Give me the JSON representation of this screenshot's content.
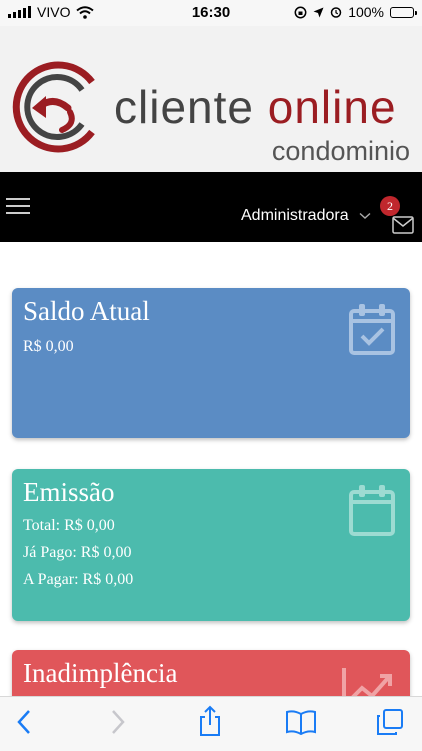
{
  "status_bar": {
    "carrier": "VIVO",
    "time": "16:30",
    "battery": "100%"
  },
  "logo": {
    "word1": "cliente",
    "word2": "online",
    "sub": "condominio"
  },
  "nav": {
    "user_menu_label": "Administradora",
    "messages_badge": "2"
  },
  "cards": {
    "saldo": {
      "title": "Saldo Atual",
      "value": "R$ 0,00",
      "color": "#5b8cc4"
    },
    "emissao": {
      "title": "Emissão",
      "total": "Total: R$ 0,00",
      "ja_pago": "Já Pago: R$ 0,00",
      "a_pagar": "A Pagar: R$ 0,00",
      "color": "#4cbbad"
    },
    "inadimplencia": {
      "title": "Inadimplência",
      "color": "#e0565a"
    }
  },
  "colors": {
    "brand_red": "#9b1d22",
    "nav_bg": "#000000",
    "ios_blue": "#1a7cf5"
  }
}
